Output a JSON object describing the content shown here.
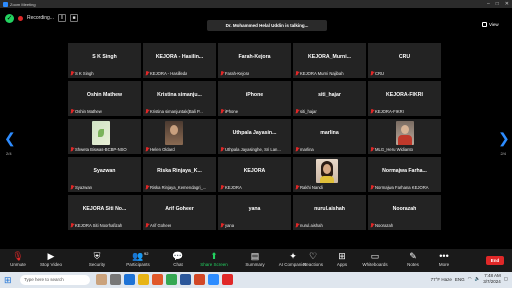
{
  "window": {
    "title": "Zoom Meeting"
  },
  "topbar": {
    "recording_label": "Recording...",
    "talking_text": "Dr. Mohammed Helal Uddin is talking...",
    "view_label": "View"
  },
  "pagination": {
    "left_page": "2/4",
    "right_page": "2/4"
  },
  "participants": [
    {
      "display": "S K Singh",
      "label": "S K Singh",
      "muted": true
    },
    {
      "display": "KEJORA - Hasilin...",
      "label": "KEJORA - Hasilleda",
      "muted": true
    },
    {
      "display": "Farah-Kejora",
      "label": "Farah-Kejora",
      "muted": true
    },
    {
      "display": "KEJORA_Murni...",
      "label": "KEJORA Murni Najibah",
      "muted": true
    },
    {
      "display": "CRU",
      "label": "CRU",
      "muted": true
    },
    {
      "display": "Oshin Mathew",
      "label": "Oshin Mathew",
      "muted": true
    },
    {
      "display": "Kristina simanju...",
      "label": "Kristina simanjuntak(Bali P...",
      "muted": true
    },
    {
      "display": "iPhone",
      "label": "iPhone",
      "muted": true
    },
    {
      "display": "siti_hajar",
      "label": "siti_hajar",
      "muted": true
    },
    {
      "display": "KEJORA-FIKRI",
      "label": "KEJORA-FIKRI",
      "muted": true
    },
    {
      "display": "",
      "label": "Shweta Biswas-BCBP-NSO",
      "muted": true,
      "video": "green"
    },
    {
      "display": "",
      "label": "Helen Oldard",
      "muted": true,
      "video": "helen"
    },
    {
      "display": "Uthpala Jayasin...",
      "label": "Uthpala Jayasinghe, Sri Lan...",
      "muted": true
    },
    {
      "display": "marlina",
      "label": "marlina",
      "muted": true
    },
    {
      "display": "",
      "label": "MLG_Heru Widianto",
      "muted": true,
      "video": "mlg"
    },
    {
      "display": "Syazwan",
      "label": "Syazwan",
      "muted": true
    },
    {
      "display": "Riska Rinjaya_K...",
      "label": "Riska Rinjaya_Kemendagri_...",
      "muted": true
    },
    {
      "display": "KEJORA",
      "label": "KEJORA",
      "muted": true
    },
    {
      "display": "",
      "label": "Rakhi Nandi",
      "muted": true,
      "video": "rakhi"
    },
    {
      "display": "Normajwa Farha...",
      "label": "Normajwa Farhana KEJORA",
      "muted": true
    },
    {
      "display": "KEJORA Siti No...",
      "label": "KEJORA Siti Noorhafizah",
      "muted": true
    },
    {
      "display": "Arif Goheer",
      "label": "Arif Goheer",
      "muted": true
    },
    {
      "display": "yana",
      "label": "yana",
      "muted": true
    },
    {
      "display": "nurul.aishah",
      "label": "nurul.aishah",
      "muted": true
    },
    {
      "display": "Noorazah",
      "label": "Noorazah",
      "muted": true
    }
  ],
  "toolbar": {
    "unmute": "Unmute",
    "stop_video": "Stop Video",
    "security": "Security",
    "participants": "Participants",
    "participants_count": "92",
    "chat": "Chat",
    "share_screen": "Share Screen",
    "summary": "Summary",
    "ai_companion": "AI Companion",
    "reactions": "Reactions",
    "apps": "Apps",
    "whiteboards": "Whiteboards",
    "notes": "Notes",
    "more": "More",
    "end": "End"
  },
  "taskbar": {
    "search_placeholder": "Type here to search",
    "weather": "77°F Haze",
    "time": "7:48 AM",
    "date": "3/7/2024",
    "lang": "ENG"
  }
}
